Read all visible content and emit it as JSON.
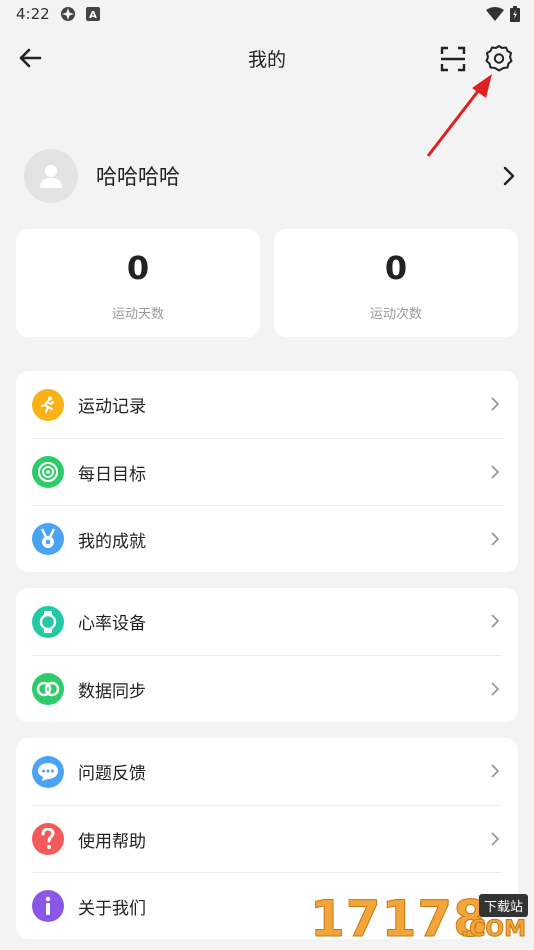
{
  "status": {
    "time": "4:22"
  },
  "appbar": {
    "title": "我的"
  },
  "profile": {
    "name": "哈哈哈哈"
  },
  "stats": [
    {
      "value": "0",
      "label": "运动天数"
    },
    {
      "value": "0",
      "label": "运动次数"
    }
  ],
  "group1": [
    {
      "label": "运动记录",
      "icon": "running-icon",
      "color": "#f9b115"
    },
    {
      "label": "每日目标",
      "icon": "target-icon",
      "color": "#2ecb6b"
    },
    {
      "label": "我的成就",
      "icon": "medal-icon",
      "color": "#4aa3f5"
    }
  ],
  "group2": [
    {
      "label": "心率设备",
      "icon": "watch-icon",
      "color": "#23c9a5"
    },
    {
      "label": "数据同步",
      "icon": "sync-rings-icon",
      "color": "#2ecb6b"
    }
  ],
  "group3": [
    {
      "label": "问题反馈",
      "icon": "chat-icon",
      "color": "#4aa3f5"
    },
    {
      "label": "使用帮助",
      "icon": "help-icon",
      "color": "#f55a5a"
    },
    {
      "label": "关于我们",
      "icon": "info-icon",
      "color": "#8a57e6"
    }
  ],
  "watermark": {
    "number": "17178",
    "badge": "下载站",
    "suffix": ".COM"
  },
  "colors": {
    "background": "#f3f3f3",
    "card": "#ffffff",
    "annotation_arrow": "#e02020"
  }
}
